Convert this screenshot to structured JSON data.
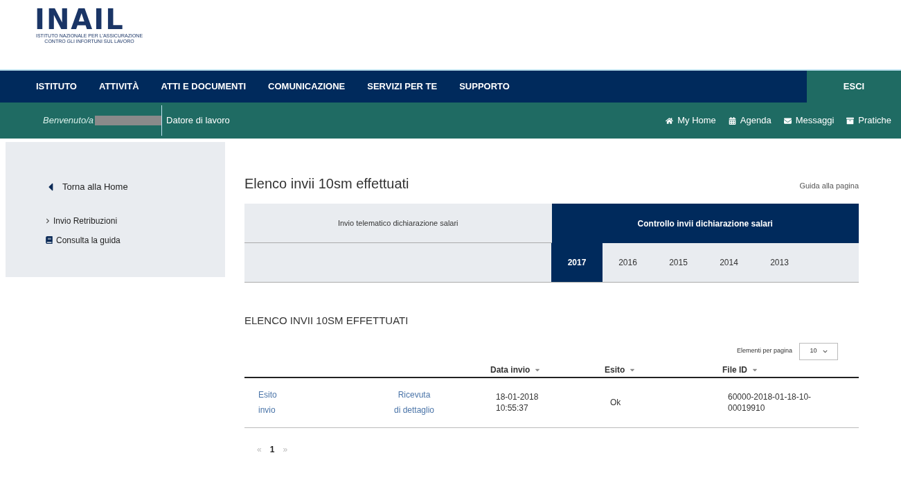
{
  "logo": {
    "wordmark": "INAIL",
    "subtitle_lines": [
      "ISTITUTO NAZIONALE PER L'ASSICURAZIONE",
      "CONTRO GLI INFORTUNI SUL LAVORO"
    ]
  },
  "main_nav": {
    "items": [
      "ISTITUTO",
      "ATTIVITÀ",
      "ATTI E DOCUMENTI",
      "COMUNICAZIONE",
      "SERVIZI PER TE",
      "SUPPORTO"
    ],
    "logout": "ESCI"
  },
  "user_bar": {
    "welcome": "Benvenuto/a",
    "role": "Datore di lavoro",
    "links": [
      {
        "kind": "home",
        "label": "My Home"
      },
      {
        "kind": "calendar",
        "label": "Agenda"
      },
      {
        "kind": "mail",
        "label": "Messaggi"
      },
      {
        "kind": "folder",
        "label": "Pratiche"
      }
    ]
  },
  "sidebar": {
    "back": "Torna alla Home",
    "items": [
      {
        "kind": "chevron",
        "label": "Invio Retribuzioni"
      },
      {
        "kind": "book",
        "label": "Consulta la guida"
      }
    ]
  },
  "page": {
    "title": "Elenco invii 10sm effettuati",
    "help_link": "Guida alla pagina"
  },
  "tabs": [
    {
      "label": "Invio telematico dichiarazione salari",
      "selected": false
    },
    {
      "label": "Controllo invii dichiarazione salari",
      "selected": true
    }
  ],
  "years": [
    {
      "label": "2017",
      "selected": true
    },
    {
      "label": "2016",
      "selected": false
    },
    {
      "label": "2015",
      "selected": false
    },
    {
      "label": "2014",
      "selected": false
    },
    {
      "label": "2013",
      "selected": false
    }
  ],
  "section_title": "ELENCO INVII 10SM EFFETTUATI",
  "page_size": {
    "label": "Elementi per pagina",
    "value": "10"
  },
  "table": {
    "columns": [
      "Data invio",
      "Esito",
      "File ID"
    ],
    "rows": [
      {
        "links": [
          [
            "Esito",
            "invio"
          ],
          [
            "Ricevuta",
            "di dettaglio"
          ]
        ],
        "date": [
          "18-01-2018",
          "10:55:37"
        ],
        "result": "Ok",
        "file_id": [
          "60000-2018-01-18-10-",
          "00019910"
        ]
      }
    ]
  },
  "pagination": {
    "first": "«",
    "pages": [
      {
        "label": "1",
        "selected": true
      }
    ],
    "last": "»"
  }
}
